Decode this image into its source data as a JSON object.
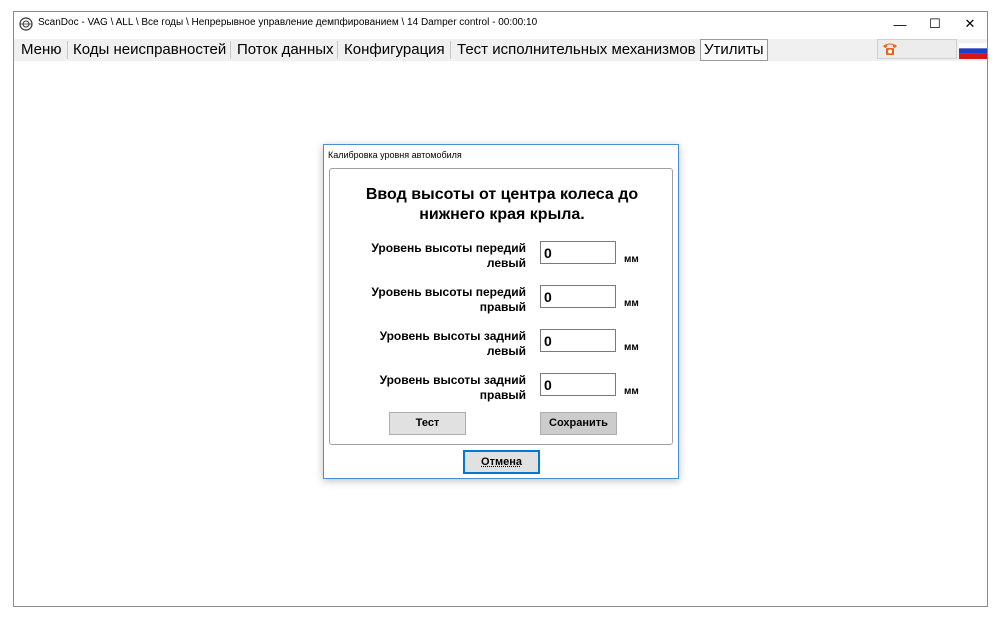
{
  "window": {
    "title": "ScanDoc - VAG \\ ALL \\ Все годы \\ Непрерывное управление демпфированием \\ 14 Damper control - 00:00:10",
    "controls": {
      "minimize": "—",
      "maximize": "☐",
      "close": "✕"
    }
  },
  "menu": {
    "items": [
      {
        "label": "Меню"
      },
      {
        "label": "Коды неисправностей"
      },
      {
        "label": "Поток данных"
      },
      {
        "label": "Конфигурация"
      },
      {
        "label": "Тест исполнительных механизмов"
      },
      {
        "label": "Утилиты",
        "active": true
      }
    ],
    "phone_icon": "phone-icon",
    "phone_color": "#e8641e",
    "flag_icon": "russian-flag-icon"
  },
  "dialog": {
    "title": "Калибровка уровня автомобиля",
    "heading": "Ввод высоты от центра колеса до нижнего края крыла.",
    "rows": [
      {
        "label": "Уровень высоты передий левый",
        "value": "0",
        "unit": "мм"
      },
      {
        "label": "Уровень высоты передий правый",
        "value": "0",
        "unit": "мм"
      },
      {
        "label": "Уровень высоты задний левый",
        "value": "0",
        "unit": "мм"
      },
      {
        "label": "Уровень высоты задний правый",
        "value": "0",
        "unit": "мм"
      }
    ],
    "test_button": "Тест",
    "save_button": "Сохранить",
    "cancel_button": "Отмена",
    "accent_color": "#0078d7"
  }
}
